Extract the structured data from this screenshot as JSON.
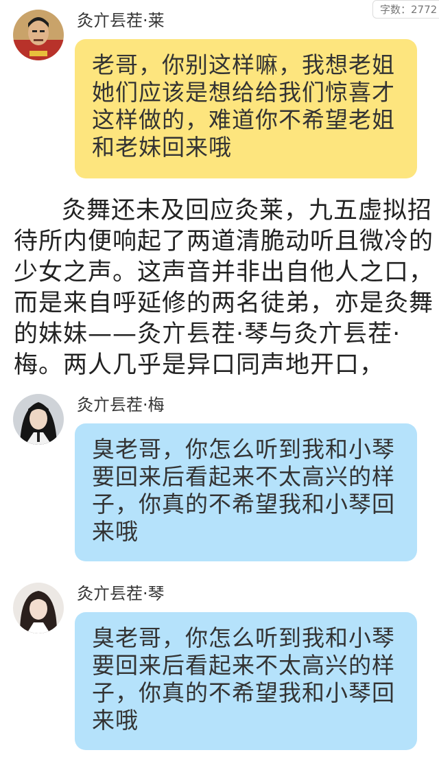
{
  "word_count": "字数：2772",
  "messages": [
    {
      "name": "灸亣镸茬·莱",
      "text": "老哥，你别这样嘛，我想老姐她们应该是想给给我们惊喜才这样做的，难道你不希望老姐和老妹回来哦",
      "bubble_color": "#fde57e",
      "avatar_icon": "avatar-man-icon"
    },
    {
      "name": "灸亣镸茬·梅",
      "text": "臭老哥，你怎么听到我和小琴要回来后看起来不太高兴的样子，你真的不希望我和小琴回来哦",
      "bubble_color": "#b5e2fb",
      "avatar_icon": "avatar-girl-icon"
    },
    {
      "name": "灸亣镸茬·琴",
      "text": "臭老哥，你怎么听到我和小琴要回来后看起来不太高兴的样子，你真的不希望我和小琴回来哦",
      "bubble_color": "#b5e2fb",
      "avatar_icon": "avatar-girl-icon"
    }
  ],
  "narration": "灸舞还未及回应灸莱，九五虚拟招待所内便响起了两道清脆动听且微冷的少女之声。这声音并非出自他人之口，而是来自呼延修的两名徒弟，亦是灸舞的妹妹——灸亣镸茬·琴与灸亣镸茬·梅。两人几乎是异口同声地开口，"
}
